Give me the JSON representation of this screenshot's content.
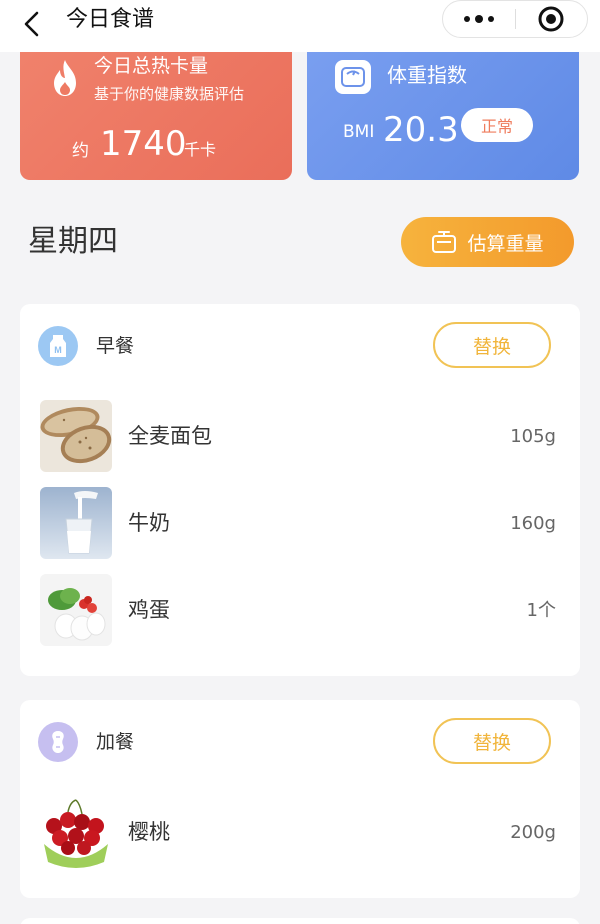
{
  "header": {
    "title": "今日食谱",
    "more_icon": "more-dots-icon",
    "target_icon": "target-icon"
  },
  "calorie_card": {
    "title": "今日总热卡量",
    "subtitle": "基于你的健康数据评估",
    "prefix": "约",
    "value": "1740",
    "unit": "千卡",
    "icon": "flame-icon",
    "color": "#ea6e5a"
  },
  "bmi_card": {
    "title": "体重指数",
    "label": "BMI",
    "value": "20.3",
    "status": "正常",
    "icon": "scale-icon",
    "color": "#5f8ae6"
  },
  "day": {
    "title": "星期四",
    "estimate_label": "估算重量",
    "estimate_icon": "weighing-scale-icon"
  },
  "meals": [
    {
      "name": "早餐",
      "icon": "milk-carton-icon",
      "swap_label": "替换",
      "foods": [
        {
          "name": "全麦面包",
          "amount": "105g"
        },
        {
          "name": "牛奶",
          "amount": "160g"
        },
        {
          "name": "鸡蛋",
          "amount": "1个"
        }
      ]
    },
    {
      "name": "加餐",
      "icon": "peanut-icon",
      "swap_label": "替换",
      "foods": [
        {
          "name": "樱桃",
          "amount": "200g"
        }
      ]
    }
  ],
  "colors": {
    "accent": "#f3a233",
    "swap_border": "#f1c355"
  }
}
